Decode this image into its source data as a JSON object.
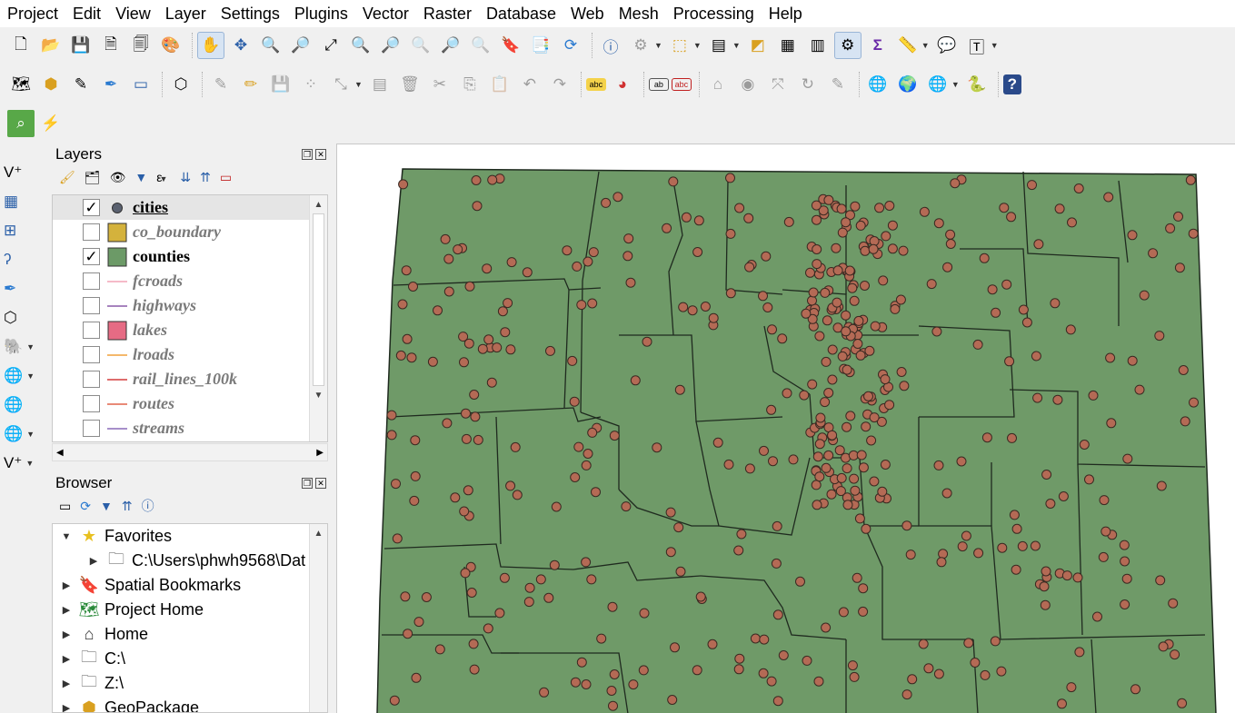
{
  "menu": [
    "Project",
    "Edit",
    "View",
    "Layer",
    "Settings",
    "Plugins",
    "Vector",
    "Raster",
    "Database",
    "Web",
    "Mesh",
    "Processing",
    "Help"
  ],
  "layers_panel": {
    "title": "Layers",
    "layers": [
      {
        "name": "cities",
        "checked": true,
        "symbol": "point",
        "color": "#5a6170",
        "selected": true
      },
      {
        "name": "co_boundary",
        "checked": false,
        "symbol": "fill",
        "color": "#d4b23c"
      },
      {
        "name": "counties",
        "checked": true,
        "symbol": "fill",
        "color": "#6c9a67"
      },
      {
        "name": "fcroads",
        "checked": false,
        "symbol": "line",
        "color": "#f2a3b6"
      },
      {
        "name": "highways",
        "checked": false,
        "symbol": "line",
        "color": "#8a5aa8"
      },
      {
        "name": "lakes",
        "checked": false,
        "symbol": "fill",
        "color": "#e66b84"
      },
      {
        "name": "lroads",
        "checked": false,
        "symbol": "line",
        "color": "#f0a13a"
      },
      {
        "name": "rail_lines_100k",
        "checked": false,
        "symbol": "line",
        "color": "#d33b3b"
      },
      {
        "name": "routes",
        "checked": false,
        "symbol": "line",
        "color": "#e0644a"
      },
      {
        "name": "streams",
        "checked": false,
        "symbol": "line",
        "color": "#8a6ab8"
      }
    ]
  },
  "browser_panel": {
    "title": "Browser",
    "items": [
      {
        "label": "Favorites",
        "icon": "star-icon",
        "expanded": true,
        "indent": 0
      },
      {
        "label": "C:\\Users\\phwh9568\\Dat",
        "icon": "folder-icon",
        "expanded": false,
        "indent": 1
      },
      {
        "label": "Spatial Bookmarks",
        "icon": "bookmark-icon",
        "expanded": false,
        "indent": 0
      },
      {
        "label": "Project Home",
        "icon": "project-home-icon",
        "expanded": false,
        "indent": 0
      },
      {
        "label": "Home",
        "icon": "home-icon",
        "expanded": false,
        "indent": 0
      },
      {
        "label": "C:\\",
        "icon": "folder-icon",
        "expanded": false,
        "indent": 0
      },
      {
        "label": "Z:\\",
        "icon": "folder-icon",
        "expanded": false,
        "indent": 0
      },
      {
        "label": "GeoPackage",
        "icon": "geopackage-icon",
        "expanded": false,
        "indent": 0
      }
    ]
  },
  "map": {
    "county_fill": "#6f9a68",
    "county_stroke": "#1f2a1f",
    "city_fill": "#b46a55",
    "city_stroke": "#3a2a22"
  }
}
